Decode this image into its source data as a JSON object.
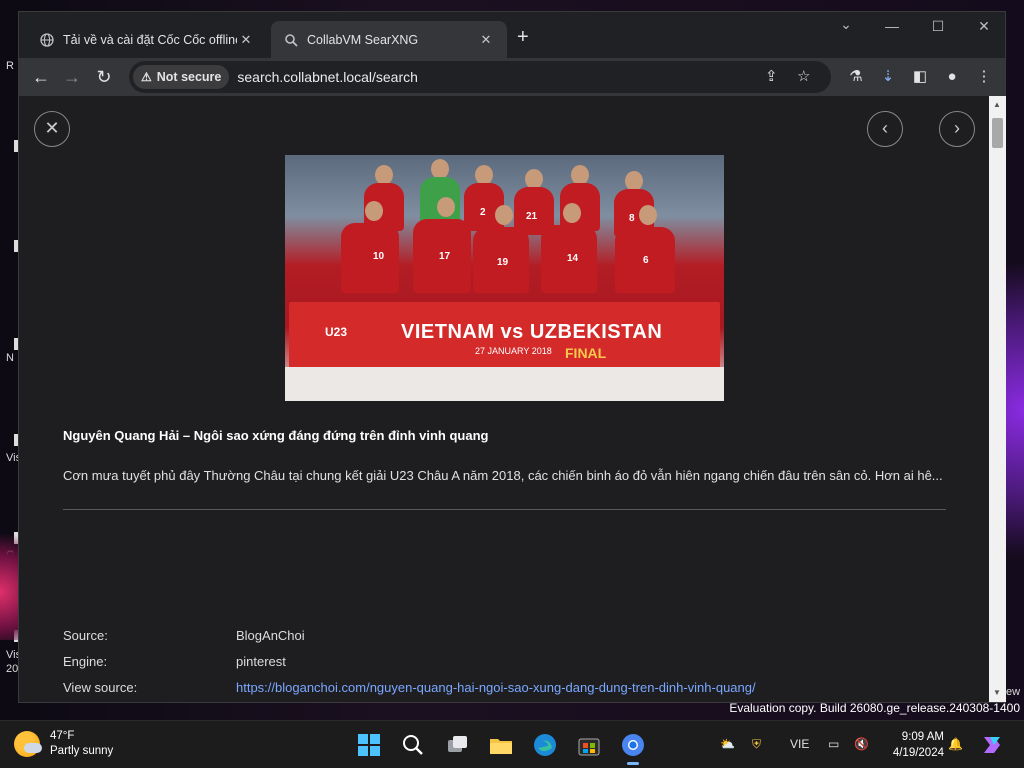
{
  "desktop": {
    "labels": [
      "R",
      "N",
      "Vis",
      "C",
      "Vis 20"
    ],
    "right_label": "ew"
  },
  "browser": {
    "tabs": [
      {
        "title": "Tải về và cài đặt Cốc Cốc offline",
        "icon": "globe-icon",
        "active": false
      },
      {
        "title": "CollabVM SearXNG",
        "icon": "searxng-icon",
        "active": true
      }
    ],
    "address": {
      "security_label": "Not secure",
      "url": "search.collabnet.local/search"
    }
  },
  "result": {
    "title": "Nguyên Quang Hải – Ngôi sao xứng đáng đứng trên đỉnh vinh quang",
    "description": "Cơn mưa tuyết phủ đây Thường Châu tại chung kết giải U23 Châu A năm 2018, các chiến binh áo đỏ vẫn hiên ngang chiến đâu trên sân cỏ. Hơn ai hê...",
    "image": {
      "banner_text": "VIETNAM vs UZBEKISTAN",
      "banner_date": "27 JANUARY 2018",
      "banner_final": "FINAL",
      "banner_u23": "U23",
      "jersey_numbers": [
        "2",
        "21",
        "8",
        "10",
        "17",
        "19",
        "14",
        "6"
      ]
    },
    "meta": {
      "source_label": "Source:",
      "source_value": "BlogAnChoi",
      "engine_label": "Engine:",
      "engine_value": "pinterest",
      "view_label": "View source:",
      "view_value": "https://bloganchoi.com/nguyen-quang-hai-ngoi-sao-xung-dang-dung-tren-dinh-vinh-quang/"
    }
  },
  "watermark": "Evaluation copy. Build 26080.ge_release.240308-1400",
  "taskbar": {
    "weather_temp": "47°F",
    "weather_desc": "Partly sunny",
    "language": "VIE",
    "time": "9:09 AM",
    "date": "4/19/2024"
  },
  "colors": {
    "page_bg": "#1e1e20",
    "link": "#7aa7ff",
    "jersey_red": "#c11c22"
  }
}
